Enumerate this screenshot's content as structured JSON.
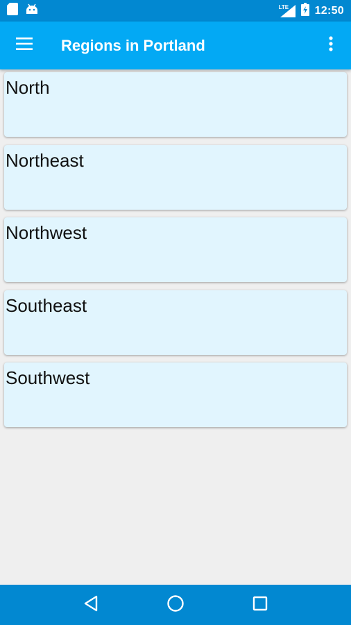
{
  "status_bar": {
    "time": "12:50",
    "network": "LTE",
    "left_icons": [
      "sd-card-icon",
      "android-icon"
    ],
    "right_icons": [
      "signal-icon",
      "battery-charging-icon"
    ]
  },
  "app_bar": {
    "title": "Regions in Portland",
    "color": "#03a9f4"
  },
  "regions": [
    {
      "label": "North"
    },
    {
      "label": "Northeast"
    },
    {
      "label": "Northwest"
    },
    {
      "label": "Southeast"
    },
    {
      "label": "Southwest"
    }
  ],
  "nav_bar": {
    "buttons": [
      "back-icon",
      "home-icon",
      "recents-icon"
    ],
    "color": "#0288d1"
  },
  "colors": {
    "card_background": "#e1f5fe",
    "page_background": "#efefef",
    "status_bar": "#0288d1"
  }
}
